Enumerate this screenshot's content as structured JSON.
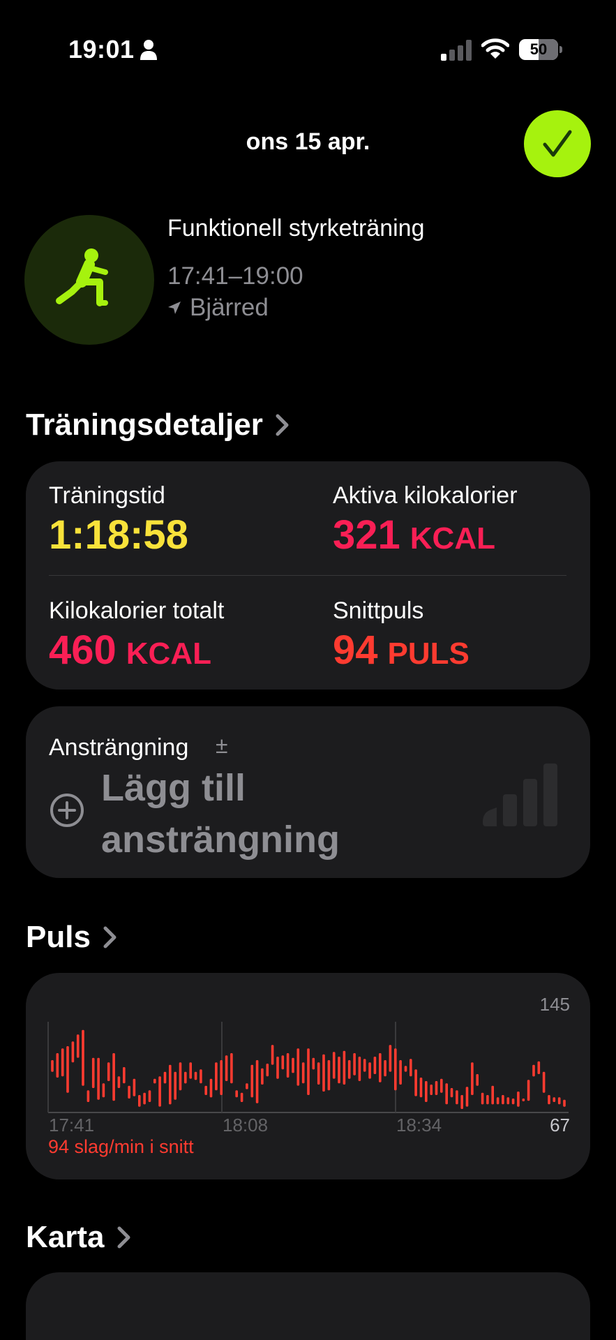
{
  "status_bar": {
    "time": "19:01",
    "battery": "50",
    "battery_level": 0.5
  },
  "header": {
    "date": "ons 15 apr.",
    "done_icon": "checkmark-icon",
    "accent_color": "#a6f20e"
  },
  "workout": {
    "name": "Funktionell styrketräning",
    "time_range": "17:41–19:00",
    "location": "Bjärred",
    "icon": "functional-strength-icon"
  },
  "details": {
    "title": "Träningsdetaljer",
    "metrics": [
      {
        "label": "Träningstid",
        "value": "1:18:58",
        "unit": "",
        "color": "#f9e23a"
      },
      {
        "label": "Aktiva kilokalorier",
        "value": "321",
        "unit": "KCAL",
        "color": "#fa1f55"
      },
      {
        "label": "Kilokalorier totalt",
        "value": "460",
        "unit": "KCAL",
        "color": "#fa1f55"
      },
      {
        "label": "Snittpuls",
        "value": "94",
        "unit": "PULS",
        "color": "#ff3b30"
      }
    ]
  },
  "effort": {
    "label": "Ansträngning",
    "plusminus": "±",
    "add_label": "Lägg till ansträngning"
  },
  "heart_rate": {
    "title": "Puls",
    "average_text": "94 slag/min i snitt"
  },
  "map": {
    "title": "Karta"
  },
  "chart_data": {
    "type": "bar",
    "title": "",
    "series_color": "#ff3b30",
    "ylim": [
      67,
      145
    ],
    "y_ticks": [
      "145",
      "67"
    ],
    "x_ticks": [
      "17:41",
      "18:08",
      "18:34"
    ],
    "ranges": [
      [
        102,
        112
      ],
      [
        97,
        118
      ],
      [
        98,
        122
      ],
      [
        84,
        124
      ],
      [
        110,
        128
      ],
      [
        114,
        134
      ],
      [
        90,
        138
      ],
      [
        76,
        86
      ],
      [
        88,
        114
      ],
      [
        78,
        114
      ],
      [
        80,
        92
      ],
      [
        94,
        110
      ],
      [
        77,
        118
      ],
      [
        88,
        98
      ],
      [
        92,
        106
      ],
      [
        79,
        90
      ],
      [
        81,
        96
      ],
      [
        72,
        82
      ],
      [
        74,
        84
      ],
      [
        76,
        86
      ],
      [
        92,
        96
      ],
      [
        72,
        98
      ],
      [
        92,
        102
      ],
      [
        74,
        108
      ],
      [
        78,
        102
      ],
      [
        86,
        110
      ],
      [
        92,
        102
      ],
      [
        96,
        110
      ],
      [
        95,
        102
      ],
      [
        92,
        104
      ],
      [
        82,
        90
      ],
      [
        80,
        96
      ],
      [
        86,
        110
      ],
      [
        82,
        112
      ],
      [
        94,
        116
      ],
      [
        92,
        118
      ],
      [
        80,
        86
      ],
      [
        76,
        84
      ],
      [
        87,
        92
      ],
      [
        80,
        108
      ],
      [
        75,
        112
      ],
      [
        91,
        105
      ],
      [
        98,
        109
      ],
      [
        108,
        125
      ],
      [
        96,
        115
      ],
      [
        104,
        116
      ],
      [
        97,
        118
      ],
      [
        101,
        114
      ],
      [
        90,
        122
      ],
      [
        92,
        110
      ],
      [
        82,
        122
      ],
      [
        104,
        114
      ],
      [
        91,
        110
      ],
      [
        85,
        117
      ],
      [
        86,
        112
      ],
      [
        96,
        119
      ],
      [
        92,
        115
      ],
      [
        91,
        120
      ],
      [
        96,
        112
      ],
      [
        99,
        118
      ],
      [
        94,
        115
      ],
      [
        102,
        113
      ],
      [
        96,
        110
      ],
      [
        100,
        115
      ],
      [
        93,
        118
      ],
      [
        98,
        112
      ],
      [
        102,
        125
      ],
      [
        86,
        122
      ],
      [
        91,
        112
      ],
      [
        102,
        107
      ],
      [
        98,
        113
      ],
      [
        81,
        104
      ],
      [
        80,
        97
      ],
      [
        76,
        94
      ],
      [
        82,
        91
      ],
      [
        82,
        94
      ],
      [
        84,
        96
      ],
      [
        74,
        92
      ],
      [
        80,
        88
      ],
      [
        74,
        86
      ],
      [
        70,
        82
      ],
      [
        72,
        89
      ],
      [
        82,
        110
      ],
      [
        90,
        100
      ],
      [
        74,
        84
      ],
      [
        74,
        82
      ],
      [
        74,
        90
      ],
      [
        74,
        80
      ],
      [
        74,
        82
      ],
      [
        74,
        80
      ],
      [
        74,
        79
      ],
      [
        72,
        85
      ],
      [
        77,
        79
      ],
      [
        77,
        95
      ],
      [
        98,
        108
      ],
      [
        100,
        111
      ],
      [
        84,
        102
      ],
      [
        74,
        82
      ],
      [
        76,
        80
      ],
      [
        74,
        80
      ],
      [
        72,
        78
      ]
    ]
  }
}
